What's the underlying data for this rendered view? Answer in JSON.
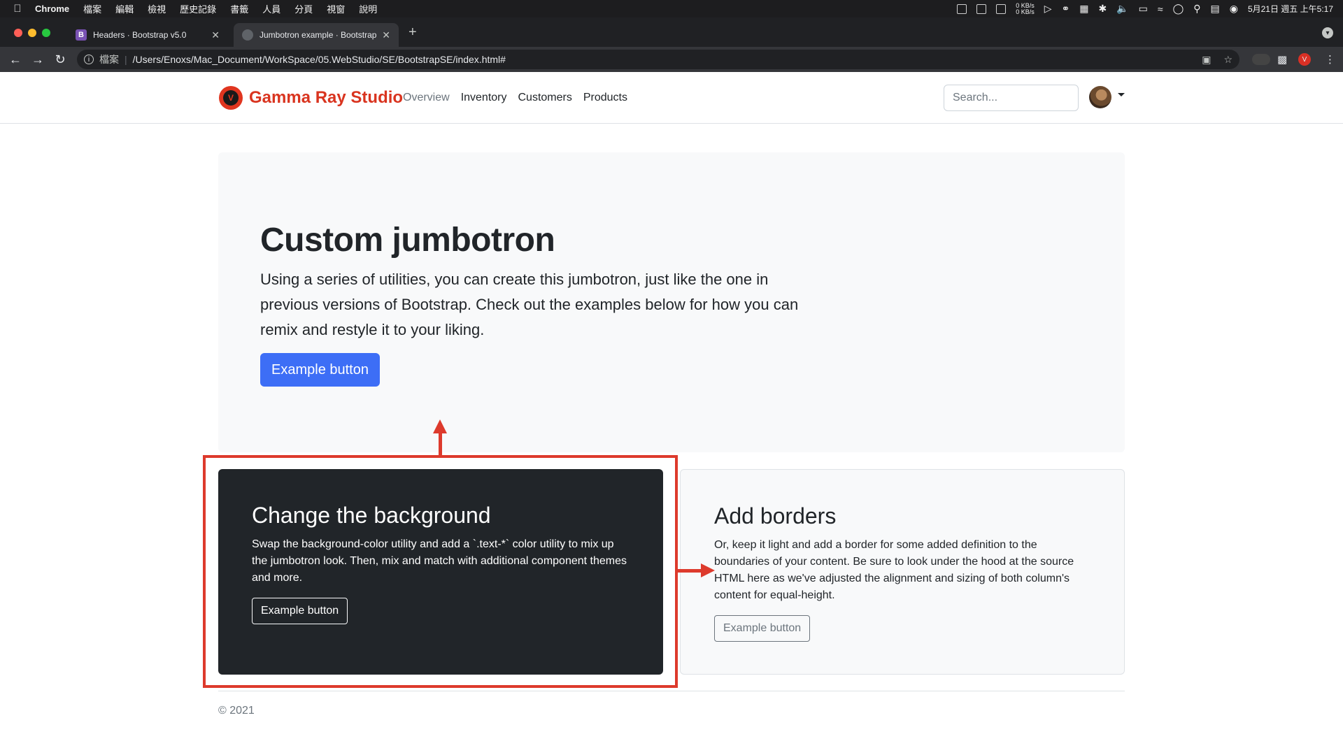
{
  "menubar": {
    "apple_icon": "apple-logo-icon",
    "app_name": "Chrome",
    "menus": [
      "檔案",
      "編輯",
      "檢視",
      "歷史記錄",
      "書籤",
      "人員",
      "分頁",
      "視窗",
      "說明"
    ],
    "net_up": "0 KB/s",
    "net_down": "0 KB/s",
    "datetime": "5月21日 週五 上午5:17"
  },
  "browser": {
    "tabs": [
      {
        "title": "Headers · Bootstrap v5.0",
        "favicon": "B",
        "active": false
      },
      {
        "title": "Jumbotron example · Bootstrap",
        "favicon": "",
        "active": true
      }
    ],
    "omnibox": {
      "scheme_label": "檔案",
      "url": "/Users/Enoxs/Mac_Document/WorkSpace/05.WebStudio/SE/BootstrapSE/index.html#"
    }
  },
  "navbar": {
    "brand": "Gamma Ray Studio",
    "brand_logo_letter": "V",
    "links": [
      "Overview",
      "Inventory",
      "Customers",
      "Products"
    ],
    "active_link": "Overview",
    "search_placeholder": "Search..."
  },
  "jumbotron": {
    "title": "Custom jumbotron",
    "lead": "Using a series of utilities, you can create this jumbotron, just like the one in previous versions of Bootstrap. Check out the examples below for how you can remix and restyle it to your liking.",
    "button": "Example button"
  },
  "cards": {
    "dark": {
      "title": "Change the background",
      "text": "Swap the background-color utility and add a `.text-*` color utility to mix up the jumbotron look. Then, mix and match with additional component themes and more.",
      "button": "Example button"
    },
    "light": {
      "title": "Add borders",
      "text": "Or, keep it light and add a border for some added definition to the boundaries of your content. Be sure to look under the hood at the source HTML here as we've adjusted the alignment and sizing of both column's content for equal-height.",
      "button": "Example button"
    }
  },
  "footer": {
    "text": "© 2021"
  },
  "colors": {
    "brand": "#d9341f",
    "primary": "#3d6ef6",
    "dark": "#212529",
    "annotation": "#dd3a2c"
  }
}
